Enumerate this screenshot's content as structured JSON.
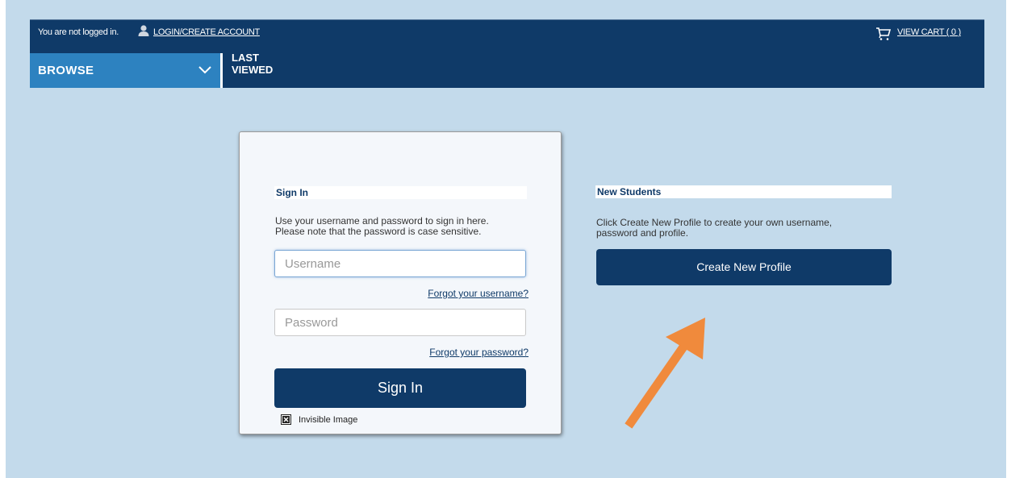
{
  "header": {
    "status_text": "You are not logged in.",
    "login_label": "LOGIN/CREATE ACCOUNT",
    "cart_label": "VIEW CART ( 0 )",
    "icons": {
      "user": "user-icon",
      "cart": "cart-icon"
    }
  },
  "nav": {
    "browse_label": "BROWSE",
    "last_viewed_label": "LAST VIEWED",
    "icons": {
      "browse": "chevron-down-icon"
    }
  },
  "signin": {
    "title": "Sign In",
    "description_line1": "Use your username and password to sign in here.",
    "description_line2": "Please note that the password is case sensitive.",
    "username_placeholder": "Username",
    "username_value": "",
    "forgot_username": "Forgot your username?",
    "password_placeholder": "Password",
    "password_value": "",
    "forgot_password": "Forgot your password?",
    "button_label": "Sign In",
    "invisible_image_label": "Invisible Image"
  },
  "new_students": {
    "title": "New Students",
    "description_line1": "Click Create New Profile to create your own username,",
    "description_line2": "password and profile.",
    "button_label": "Create New Profile"
  },
  "colors": {
    "navy": "#0f3a68",
    "browse_blue": "#2d82c0",
    "page_bg": "#c3daeb",
    "annotation_arrow": "#f08a3c"
  }
}
